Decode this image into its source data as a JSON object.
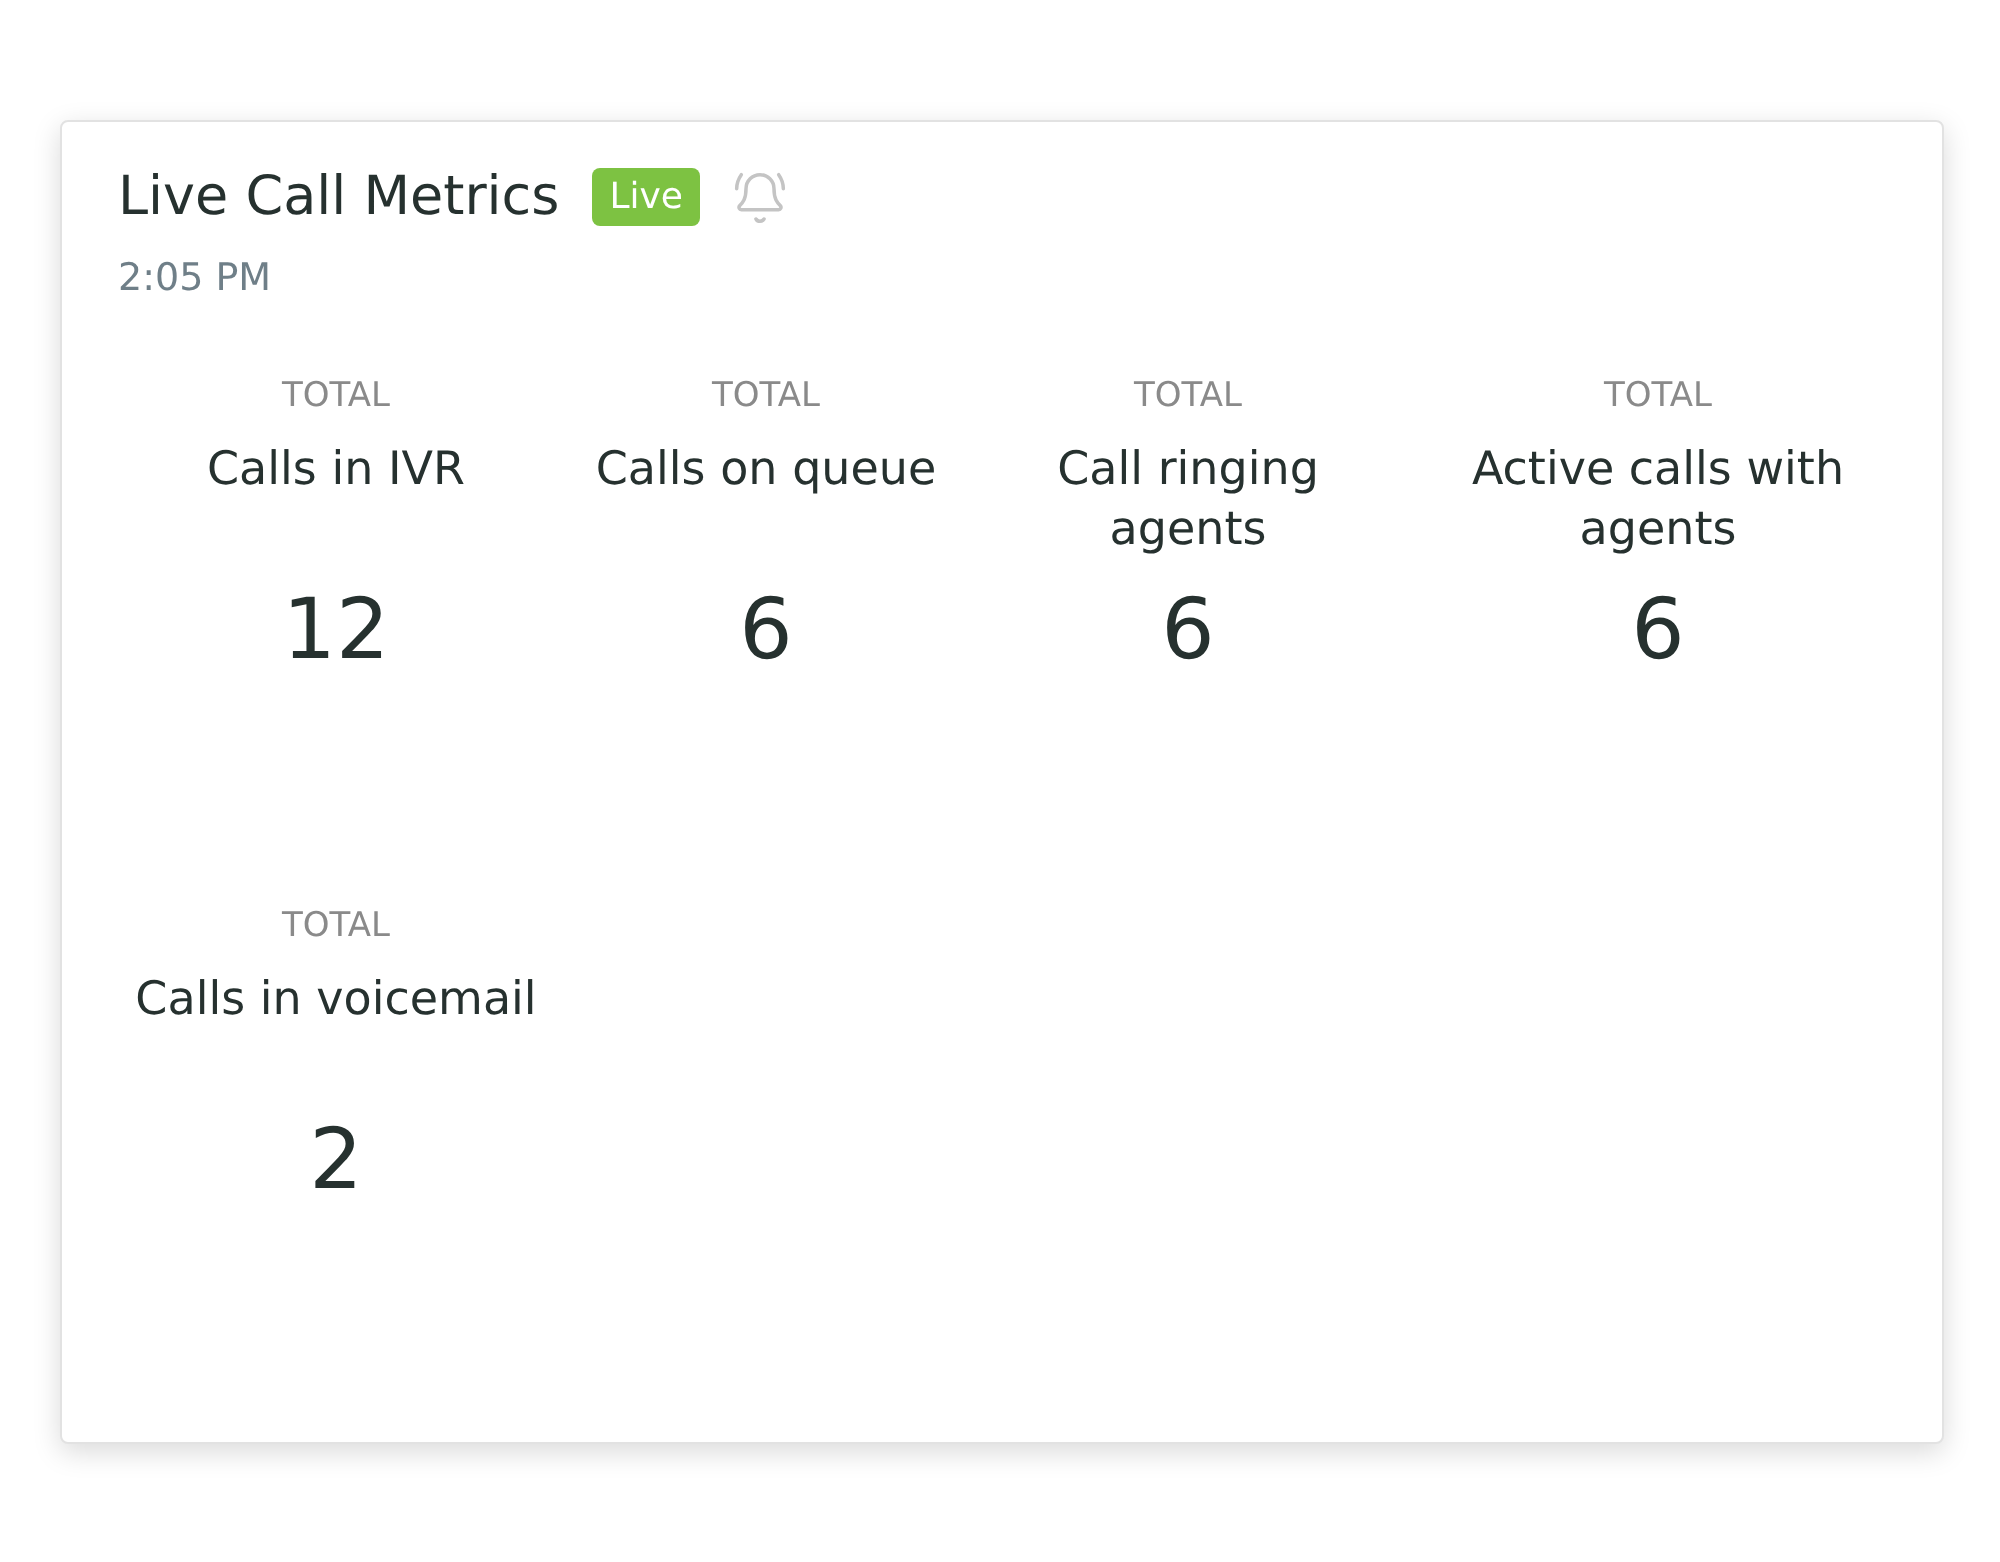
{
  "card": {
    "title": "Live Call Metrics",
    "badge": "Live",
    "time": "2:05 PM"
  },
  "metrics": [
    {
      "caption": "TOTAL",
      "label": "Calls in IVR",
      "value": "12"
    },
    {
      "caption": "TOTAL",
      "label": "Calls on queue",
      "value": "6"
    },
    {
      "caption": "TOTAL",
      "label": "Call ringing agents",
      "value": "6"
    },
    {
      "caption": "TOTAL",
      "label": "Active calls with agents",
      "value": "6"
    },
    {
      "caption": "TOTAL",
      "label": "Calls in voicemail",
      "value": "2"
    }
  ]
}
